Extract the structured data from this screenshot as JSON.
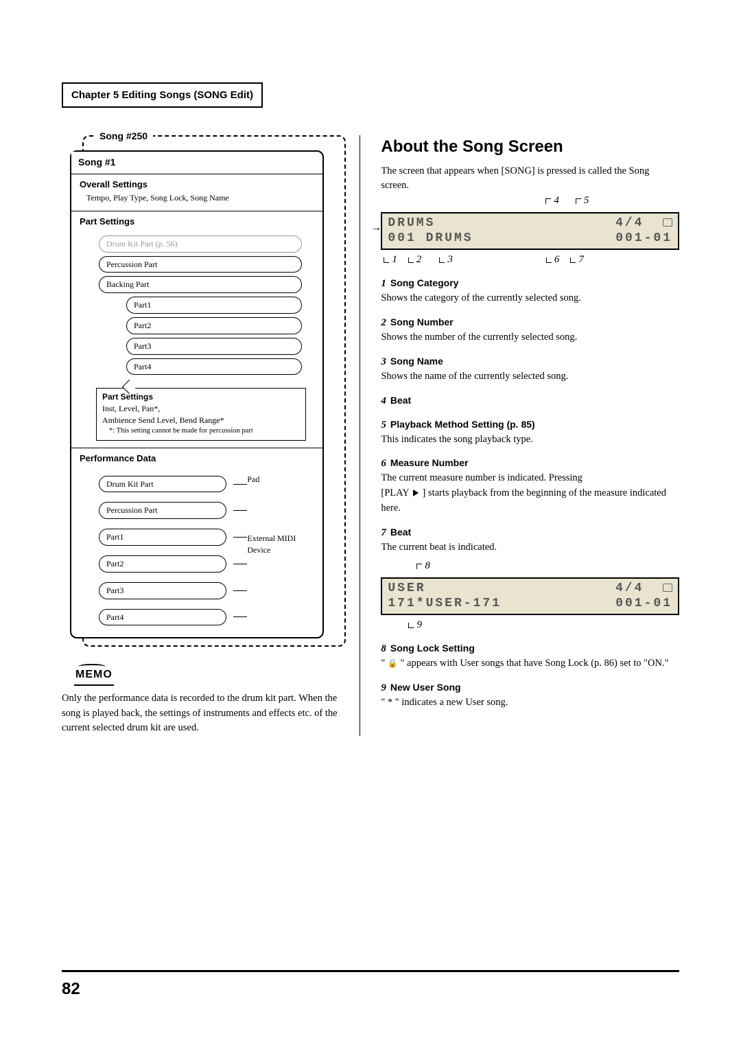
{
  "chapter_header": "Chapter 5 Editing Songs (SONG Edit)",
  "page_number": "82",
  "left": {
    "song250": "Song #250",
    "song1": "Song #1",
    "overall_head": "Overall Settings",
    "overall_body": "Tempo, Play Type, Song Lock, Song Name",
    "part_head": "Part Settings",
    "pills": {
      "drumkit": "Drum Kit Part (p. 56)",
      "perc": "Percussion Part",
      "backing": "Backing Part",
      "p1": "Part1",
      "p2": "Part2",
      "p3": "Part3",
      "p4": "Part4"
    },
    "ps_title": "Part Settings",
    "ps_line1": "Inst, Level, Pan*,",
    "ps_line2": "Ambience Send Level, Bend Range*",
    "ps_note": "*:  This setting cannot be made for percussion part",
    "perf_head": "Performance Data",
    "perf_pills": {
      "drumkit": "Drum Kit Part",
      "perc": "Percussion Part",
      "p1": "Part1",
      "p2": "Part2",
      "p3": "Part3",
      "p4": "Part4"
    },
    "pad_label": "Pad",
    "ext_label": "External MIDI Device",
    "memo_label": "MEMO",
    "memo_text": "Only the performance data is recorded to the drum kit part. When the song is played back, the settings of instruments and effects etc. of the current selected drum kit are used."
  },
  "right": {
    "heading": "About the Song Screen",
    "intro": "The screen that appears when [SONG] is pressed is called the Song screen.",
    "lcd1": {
      "r1l": "DRUMS",
      "r1r": "4/4  ",
      "r2l": "001 DRUMS",
      "r2r": "001-01"
    },
    "callouts_top1": [
      "4",
      "5"
    ],
    "callouts_bot1": [
      [
        "1",
        "4"
      ],
      [
        "2",
        "30"
      ],
      [
        "3",
        "60"
      ],
      [
        "6",
        "230"
      ],
      [
        "7",
        "280"
      ]
    ],
    "items": [
      {
        "num": "1",
        "head": "Song Category",
        "body": "Shows the category of the currently selected song."
      },
      {
        "num": "2",
        "head": "Song Number",
        "body": "Shows the number of the currently selected song."
      },
      {
        "num": "3",
        "head": "Song Name",
        "body": "Shows the name of the currently selected song."
      },
      {
        "num": "4",
        "head": "Beat",
        "body": ""
      },
      {
        "num": "5",
        "head": "Playback Method Setting (p. 85)",
        "body": "This indicates the song playback type."
      },
      {
        "num": "6",
        "head": "Measure Number",
        "body": "The current measure number is indicated. Pressing [PLAY ▶ ] starts playback from the beginning of the measure indicated here.",
        "hasplay": true
      },
      {
        "num": "7",
        "head": "Beat",
        "body": "The current beat is indicated."
      }
    ],
    "lcd2": {
      "r1l": "USER",
      "r1r": "4/4  ",
      "r2l": "171*USER-171",
      "r2r": "001-01"
    },
    "callouts_top2": [
      "8"
    ],
    "callouts_bot2": [
      "9"
    ],
    "item8": {
      "num": "8",
      "head": "Song Lock Setting",
      "body_pre": "\" ",
      "body_post": " \" appears with User songs that have Song Lock (p. 86) set to \"ON.\""
    },
    "item9": {
      "num": "9",
      "head": "New User Song",
      "body": "\" * \" indicates a new User song."
    }
  }
}
